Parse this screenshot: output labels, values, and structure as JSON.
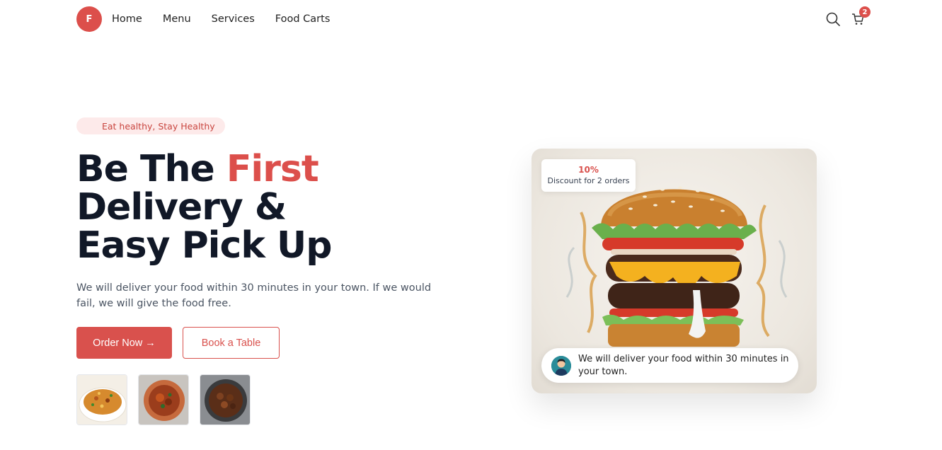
{
  "brand": {
    "logo_letter": "F",
    "color": "#dc4f4b"
  },
  "nav": {
    "items": [
      "Home",
      "Menu",
      "Services",
      "Food Carts"
    ],
    "search_icon": "search-icon",
    "cart_icon": "cart-icon",
    "cart_count": "2"
  },
  "hero": {
    "tag": "Eat healthy, Stay Healthy",
    "headline_part1": "Be The ",
    "headline_accent": "First",
    "headline_line2": "Delivery &",
    "headline_line3": "Easy Pick Up",
    "description": "We will deliver your food within 30 minutes in your town. If we would fail, we will give the food free.",
    "primary_button": "Order Now →",
    "secondary_button": "Book a Table",
    "thumbnails": [
      "biryani-thumbnail",
      "curry-pot-thumbnail",
      "fried-dish-thumbnail"
    ]
  },
  "card": {
    "discount_percent": "10%",
    "discount_text": "Discount for 2 orders",
    "delivery_message": "We will deliver your food within 30 minutes in your town."
  },
  "colors": {
    "accent": "#dc4f4b",
    "dark": "#111827",
    "tag_bg": "#fdeaea"
  }
}
